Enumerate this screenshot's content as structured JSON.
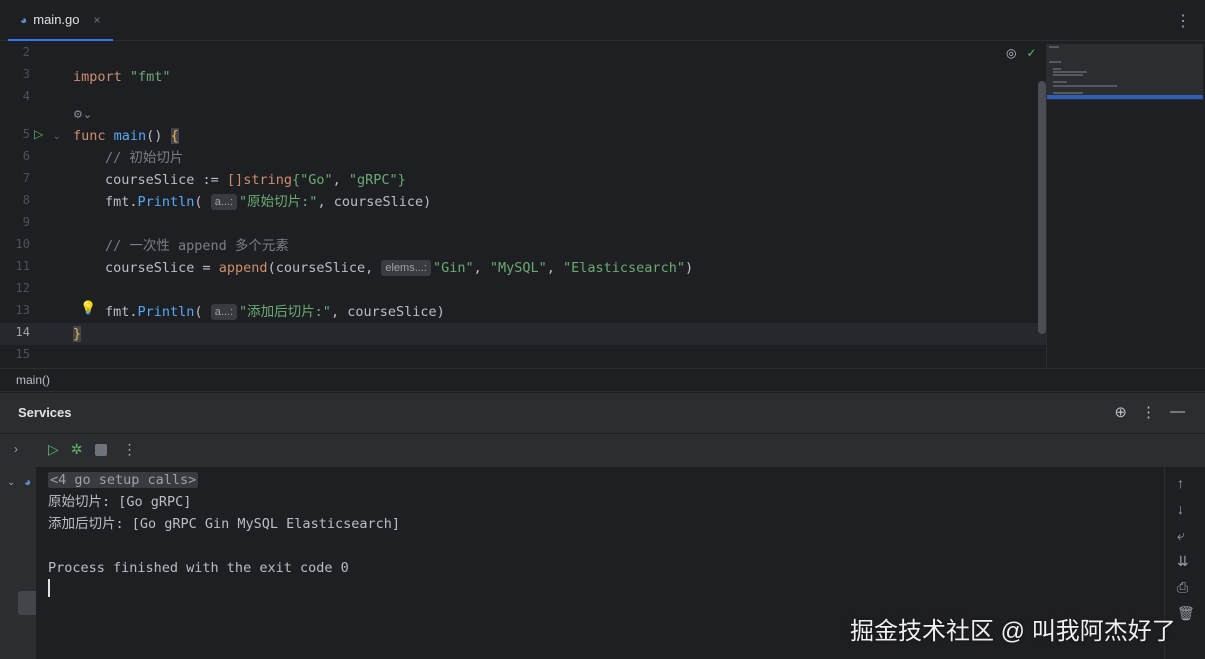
{
  "tab": {
    "title": "main.go",
    "close": "×",
    "menu": "⋮"
  },
  "editor": {
    "line_numbers": [
      "2",
      "3",
      "4",
      "5",
      "6",
      "7",
      "8",
      "9",
      "10",
      "11",
      "12",
      "13",
      "14",
      "15"
    ],
    "lines": {
      "l3": {
        "kw": "import",
        "str": "\"fmt\""
      },
      "l5": {
        "kw": "func",
        "fn": "main",
        "rest": "() ",
        "brace": "{"
      },
      "l6": {
        "comment": "// 初始切片"
      },
      "l7": {
        "ident": "courseSlice := ",
        "bracket": "[]",
        "type": "string",
        "open": "{",
        "s1": "\"Go\"",
        "comma": ", ",
        "s2": "\"gRPC\"",
        "close": "}"
      },
      "l8": {
        "pkg": "fmt.",
        "fn": "Println",
        "open": "(",
        "hint": "a...:",
        "str": "\"原始切片:\"",
        "rest": ", courseSlice)"
      },
      "l10": {
        "comment": "// 一次性 append 多个元素"
      },
      "l11": {
        "ident": "courseSlice = ",
        "fn": "append",
        "open": "(courseSlice, ",
        "hint": "elems...:",
        "s1": "\"Gin\"",
        "c1": ", ",
        "s2": "\"MySQL\"",
        "c2": ", ",
        "s3": "\"Elasticsearch\"",
        "close": ")"
      },
      "l13": {
        "pkg": "fmt.",
        "fn": "Println",
        "open": "(",
        "hint": "a...:",
        "str": "\"添加后切片:\"",
        "rest": ", courseSlice)"
      },
      "l14": {
        "brace": "}"
      }
    }
  },
  "breadcrumb": {
    "text": "main()"
  },
  "services": {
    "title": "Services",
    "console": {
      "setup": "<4 go setup calls>",
      "out1": "原始切片: [Go gRPC]",
      "out2": "添加后切片: [Go gRPC Gin MySQL Elasticsearch]",
      "exit": "Process finished with the exit code 0"
    }
  },
  "watermark": "掘金技术社区 @ 叫我阿杰好了",
  "colors": {
    "accent": "#3574f0",
    "keyword": "#cf8e6d",
    "string": "#6aab73",
    "function": "#56a8f5",
    "comment": "#7a7e85",
    "run_green": "#5fb865"
  }
}
